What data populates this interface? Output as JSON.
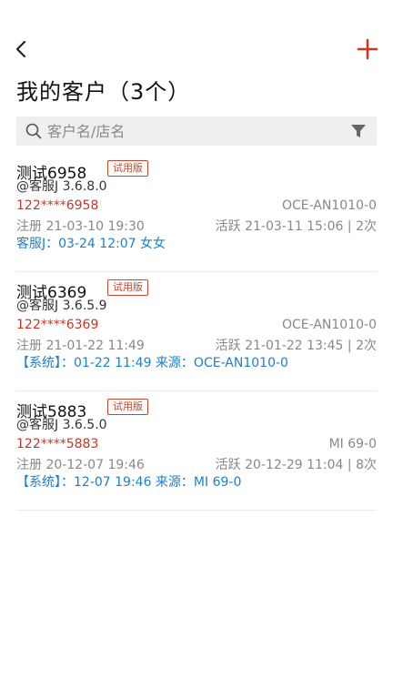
{
  "header": {
    "title": "我的客户（3个）"
  },
  "search": {
    "placeholder": "客户名/店名"
  },
  "customers": [
    {
      "name": "测试6958",
      "badge": "试用版",
      "sub": "@客服J 3.6.8.0",
      "phone": "122****6958",
      "device": "OCE-AN1010-0",
      "register": "注册 21-03-10 19:30",
      "active": "活跃 21-03-11 15:06 | 2次",
      "note": "客服J：03-24 12:07 女女"
    },
    {
      "name": "测试6369",
      "badge": "试用版",
      "sub": "@客服J 3.6.5.9",
      "phone": "122****6369",
      "device": "OCE-AN1010-0",
      "register": "注册 21-01-22 11:49",
      "active": "活跃 21-01-22 13:45 | 2次",
      "note": "【系统】：01-22 11:49 来源：OCE-AN1010-0"
    },
    {
      "name": "测试5883",
      "badge": "试用版",
      "sub": "@客服J 3.6.5.0",
      "phone": "122****5883",
      "device": "MI 69-0",
      "register": "注册 20-12-07 19:46",
      "active": "活跃 20-12-29 11:04 | 8次",
      "note": "【系统】：12-07 19:46 来源：MI 69-0"
    }
  ],
  "colors": {
    "accent": "#c8462c",
    "phone": "#c0392b",
    "note": "#1e7fc9"
  }
}
